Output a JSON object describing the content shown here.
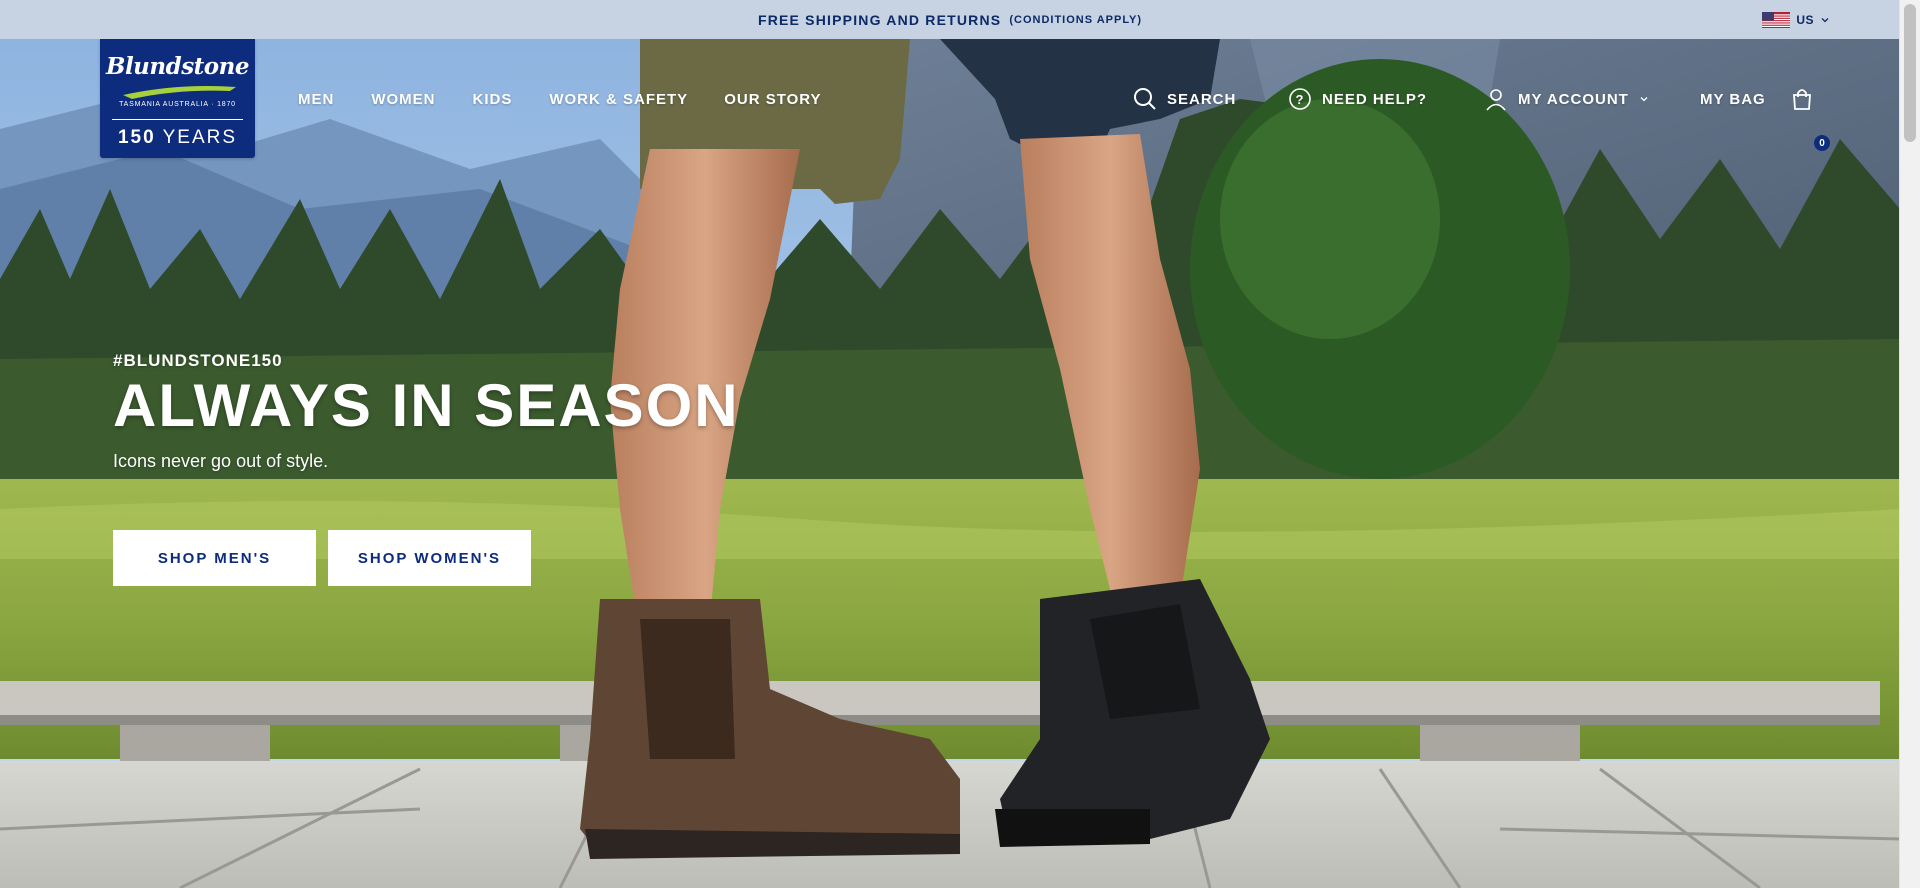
{
  "promo": {
    "main": "FREE SHIPPING AND RETURNS",
    "note": "(CONDITIONS APPLY)",
    "region": "US",
    "region_icon": "us-flag-icon"
  },
  "logo": {
    "brand": "Blundstone",
    "tagline": "TASMANIA AUSTRALIA · 1870",
    "years_num": "150",
    "years_word": "YEARS"
  },
  "nav": {
    "men": "MEN",
    "women": "WOMEN",
    "kids": "KIDS",
    "work": "WORK & SAFETY",
    "story": "OUR STORY"
  },
  "utils": {
    "search": "SEARCH",
    "help": "NEED HELP?",
    "account": "MY ACCOUNT",
    "bag": "MY BAG",
    "bag_count": "0"
  },
  "hero": {
    "hashtag": "#BLUNDSTONE150",
    "headline": "ALWAYS IN SEASON",
    "subline": "Icons never go out of style.",
    "cta_men": "SHOP MEN'S",
    "cta_women": "SHOP WOMEN'S"
  },
  "colors": {
    "brand_navy": "#0d2c7d",
    "promo_bg": "#c7d2e2"
  }
}
